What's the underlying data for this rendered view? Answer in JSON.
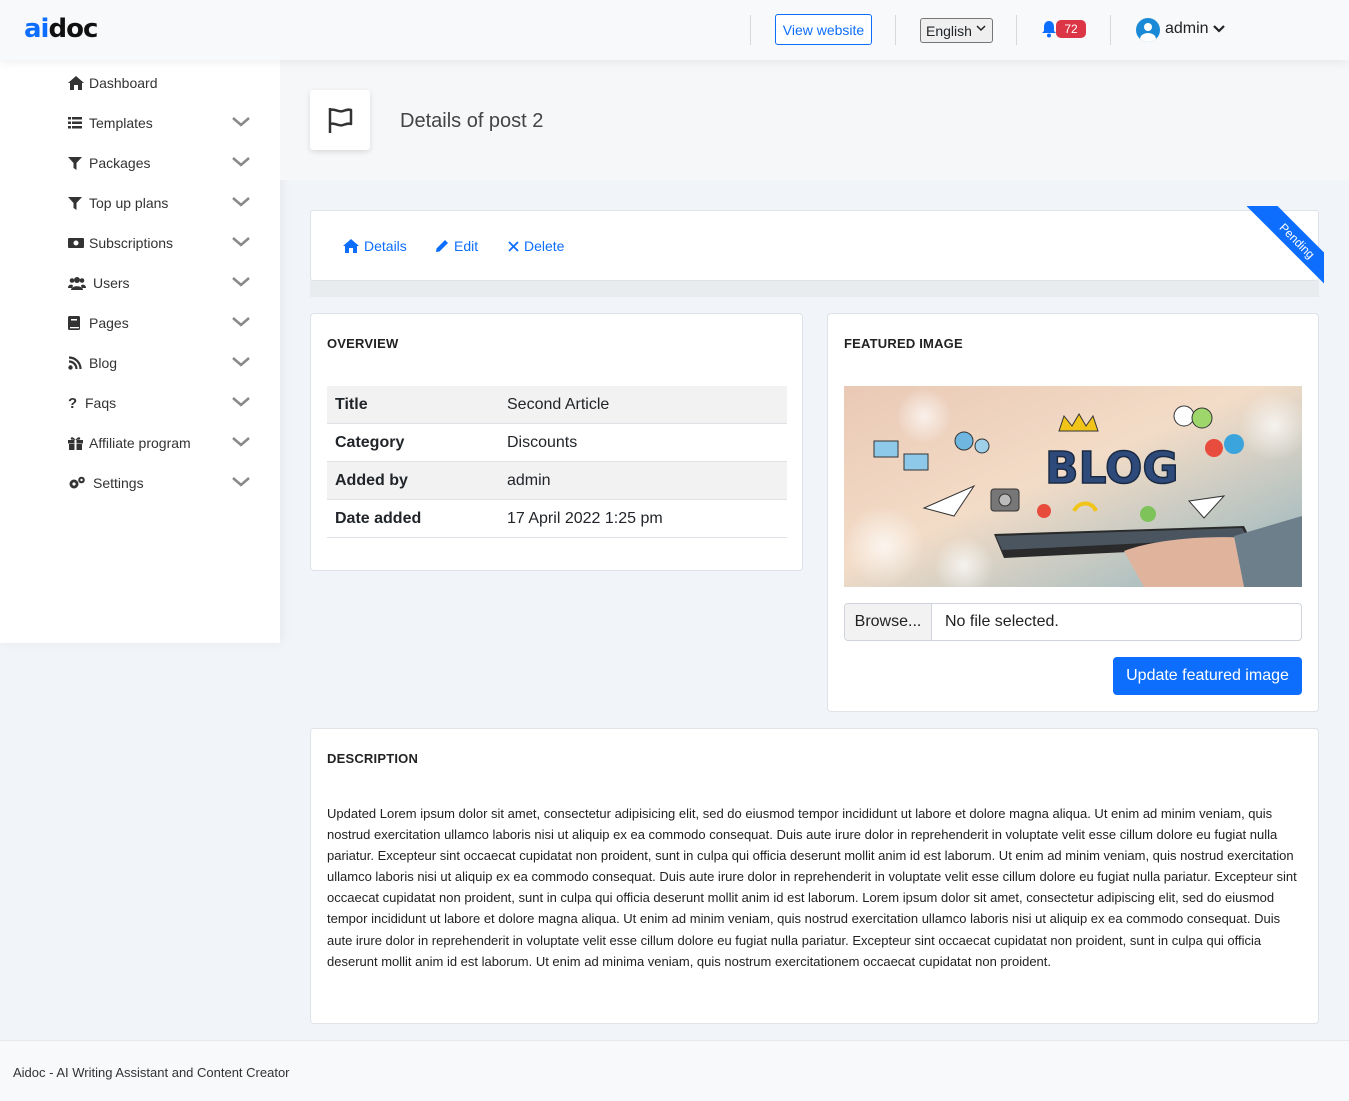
{
  "brand": {
    "logo_ai": "ai",
    "logo_doc": "doc"
  },
  "header": {
    "view_website": "View website",
    "language": "English",
    "notifications_count": "72",
    "user": "admin"
  },
  "sidebar": {
    "items": [
      {
        "label": "Dashboard",
        "icon": "home-icon"
      },
      {
        "label": "Templates",
        "icon": "list-icon"
      },
      {
        "label": "Packages",
        "icon": "filter-icon"
      },
      {
        "label": "Top up plans",
        "icon": "filter-icon"
      },
      {
        "label": "Subscriptions",
        "icon": "money-icon"
      },
      {
        "label": "Users",
        "icon": "users-icon"
      },
      {
        "label": "Pages",
        "icon": "book-icon"
      },
      {
        "label": "Blog",
        "icon": "rss-icon"
      },
      {
        "label": "Faqs",
        "icon": "question-icon"
      },
      {
        "label": "Affiliate program",
        "icon": "gift-icon"
      },
      {
        "label": "Settings",
        "icon": "cogs-icon"
      }
    ]
  },
  "page": {
    "title": "Details of post 2"
  },
  "tabs": {
    "details": "Details",
    "edit": "Edit",
    "delete": "Delete",
    "status": "Pending"
  },
  "overview": {
    "title": "OVERVIEW",
    "rows": [
      {
        "key": "Title",
        "value": "Second Article"
      },
      {
        "key": "Category",
        "value": "Discounts"
      },
      {
        "key": "Added by",
        "value": "admin"
      },
      {
        "key": "Date added",
        "value": "17 April 2022 1:25 pm"
      }
    ]
  },
  "featured": {
    "title": "FEATURED IMAGE",
    "image_text": "BLOG",
    "browse": "Browse...",
    "no_file": "No file selected.",
    "update_button": "Update featured image"
  },
  "description": {
    "title": "DESCRIPTION",
    "body": "Updated Lorem ipsum dolor sit amet, consectetur adipisicing elit, sed do eiusmod tempor incididunt ut labore et dolore magna aliqua. Ut enim ad minim veniam, quis nostrud exercitation ullamco laboris nisi ut aliquip ex ea commodo consequat. Duis aute irure dolor in reprehenderit in voluptate velit esse cillum dolore eu fugiat nulla pariatur. Excepteur sint occaecat cupidatat non proident, sunt in culpa qui officia deserunt mollit anim id est laborum. Ut enim ad minim veniam, quis nostrud exercitation ullamco laboris nisi ut aliquip ex ea commodo consequat. Duis aute irure dolor in reprehenderit in voluptate velit esse cillum dolore eu fugiat nulla pariatur. Excepteur sint occaecat cupidatat non proident, sunt in culpa qui officia deserunt mollit anim id est laborum. Lorem ipsum dolor sit amet, consectetur adipiscing elit, sed do eiusmod tempor incididunt ut labore et dolore magna aliqua. Ut enim ad minim veniam, quis nostrud exercitation ullamco laboris nisi ut aliquip ex ea commodo consequat. Duis aute irure dolor in reprehenderit in voluptate velit esse cillum dolore eu fugiat nulla pariatur. Excepteur sint occaecat cupidatat non proident, sunt in culpa qui officia deserunt mollit anim id est laborum. Ut enim ad minima veniam, quis nostrum exercitationem occaecat cupidatat non proident."
  },
  "footer": {
    "text": "Aidoc - AI Writing Assistant and Content Creator"
  },
  "colors": {
    "primary": "#0d6efd",
    "danger": "#dc3545",
    "avatar": "#1a8ad6"
  }
}
